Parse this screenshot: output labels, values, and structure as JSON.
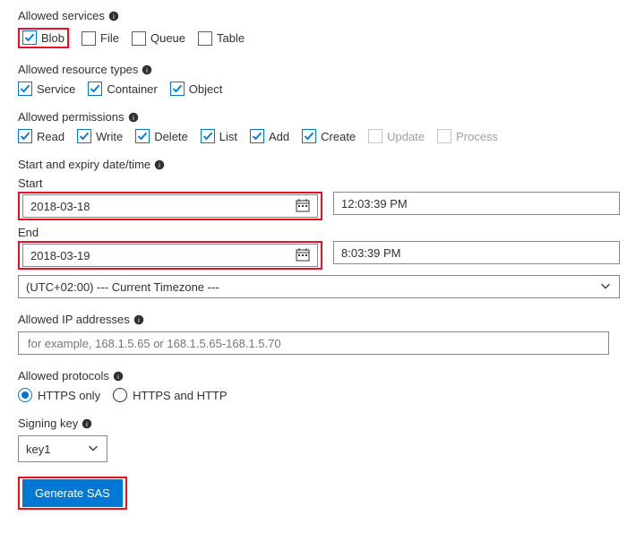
{
  "services": {
    "title": "Allowed services",
    "items": {
      "blob": "Blob",
      "file": "File",
      "queue": "Queue",
      "table": "Table"
    }
  },
  "resource_types": {
    "title": "Allowed resource types",
    "items": {
      "service": "Service",
      "container": "Container",
      "object": "Object"
    }
  },
  "permissions": {
    "title": "Allowed permissions",
    "items": {
      "read": "Read",
      "write": "Write",
      "delete": "Delete",
      "list": "List",
      "add": "Add",
      "create": "Create",
      "update": "Update",
      "process": "Process"
    }
  },
  "datetime": {
    "title": "Start and expiry date/time",
    "start_label": "Start",
    "start_date": "2018-03-18",
    "start_time": "12:03:39 PM",
    "end_label": "End",
    "end_date": "2018-03-19",
    "end_time": "8:03:39 PM",
    "timezone": "(UTC+02:00) --- Current Timezone ---"
  },
  "ip": {
    "title": "Allowed IP addresses",
    "placeholder": "for example, 168.1.5.65 or 168.1.5.65-168.1.5.70"
  },
  "protocols": {
    "title": "Allowed protocols",
    "https_only": "HTTPS only",
    "https_http": "HTTPS and HTTP"
  },
  "signing": {
    "title": "Signing key",
    "value": "key1"
  },
  "generate_button": "Generate SAS"
}
